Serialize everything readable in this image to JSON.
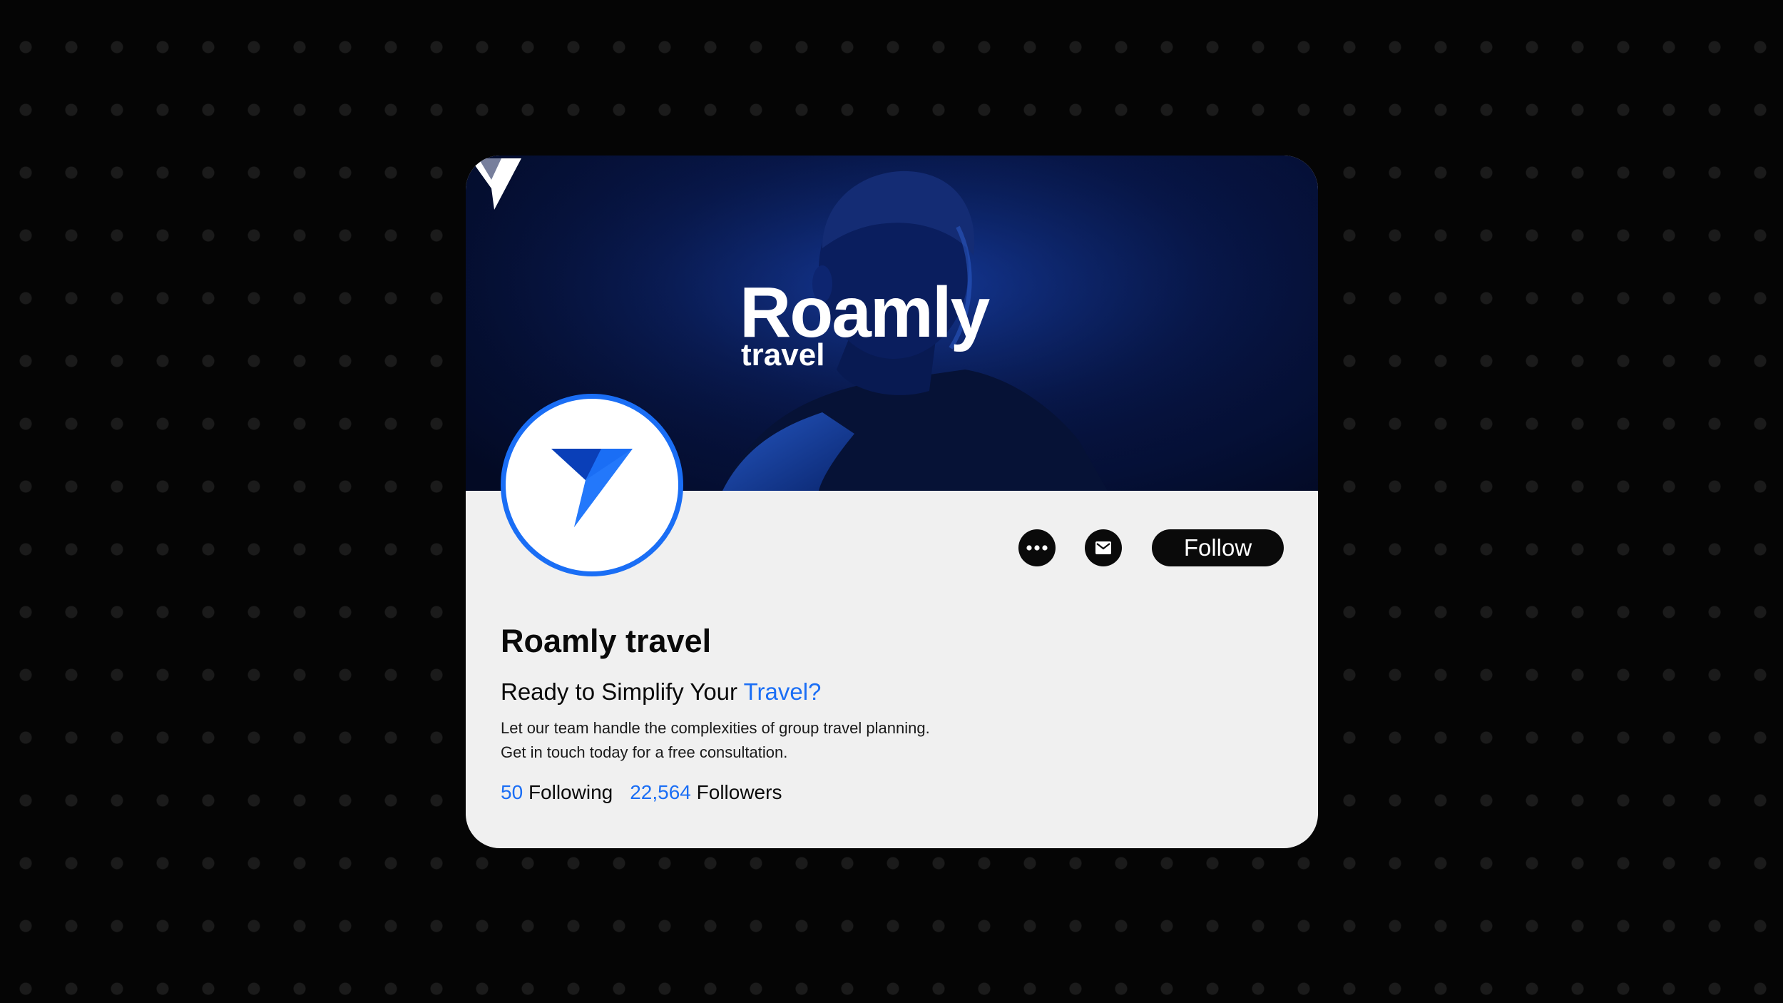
{
  "banner": {
    "brand_name": "Roamly",
    "brand_tagline": "travel"
  },
  "profile": {
    "name": "Roamly travel",
    "headline_lead": "Ready to Simplify Your ",
    "headline_accent": "Travel?",
    "description_line1": "Let our team handle the complexities of group travel planning.",
    "description_line2": "Get in touch today for a free consultation."
  },
  "actions": {
    "more_icon": "more-dots-icon",
    "message_icon": "mail-icon",
    "follow_label": "Follow"
  },
  "stats": {
    "following_count": "50",
    "following_label": "Following",
    "followers_count": "22,564",
    "followers_label": "Followers"
  },
  "colors": {
    "accent": "#1a6ef5",
    "card_background": "#f0f0f0",
    "page_background": "#050505",
    "banner_dark": "#07164a"
  }
}
